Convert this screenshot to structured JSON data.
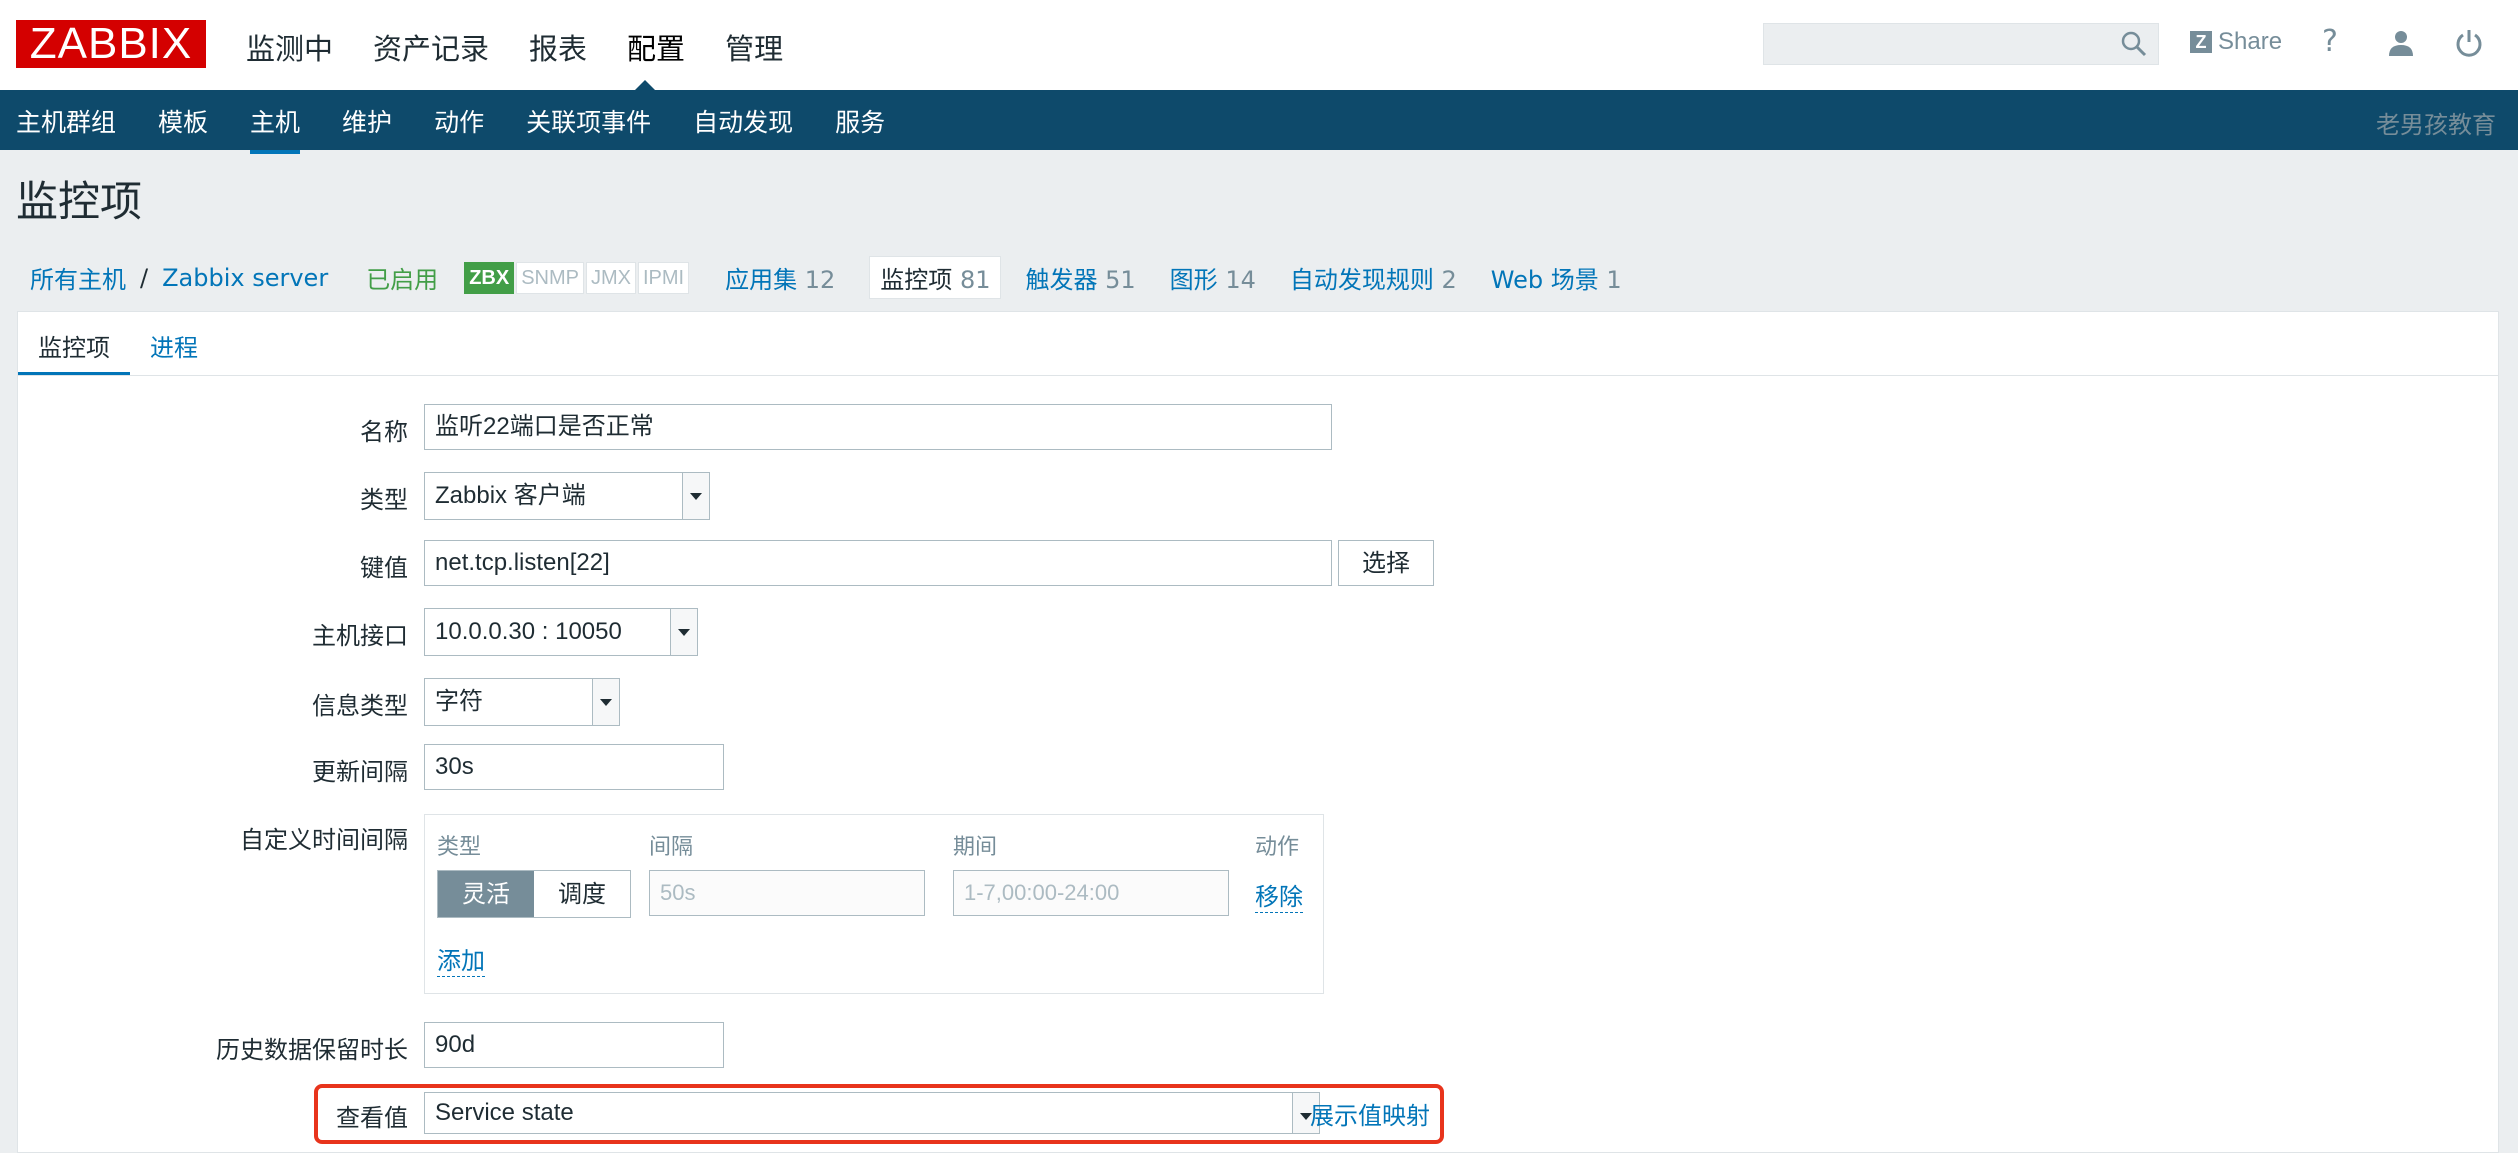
{
  "header": {
    "logo": "ZABBIX",
    "top_menu": [
      "监测中",
      "资产记录",
      "报表",
      "配置",
      "管理"
    ],
    "active_top": "配置",
    "search_placeholder": "",
    "share_label": "Share",
    "help_label": "?"
  },
  "subnav": {
    "items": [
      "主机群组",
      "模板",
      "主机",
      "维护",
      "动作",
      "关联项事件",
      "自动发现",
      "服务"
    ],
    "active": "主机",
    "brand": "老男孩教育"
  },
  "page_title": "监控项",
  "breadcrumb": {
    "all_hosts": "所有主机",
    "separator": "/",
    "host": "Zabbix server",
    "status": "已启用",
    "availability": [
      "ZBX",
      "SNMP",
      "JMX",
      "IPMI"
    ],
    "tabs": [
      {
        "label": "应用集",
        "count": "12"
      },
      {
        "label": "监控项",
        "count": "81"
      },
      {
        "label": "触发器",
        "count": "51"
      },
      {
        "label": "图形",
        "count": "14"
      },
      {
        "label": "自动发现规则",
        "count": "2"
      },
      {
        "label": "Web 场景",
        "count": "1"
      }
    ]
  },
  "form_tabs": [
    "监控项",
    "进程"
  ],
  "form": {
    "name_label": "名称",
    "name_value": "监听22端口是否正常",
    "type_label": "类型",
    "type_value": "Zabbix 客户端",
    "key_label": "键值",
    "key_value": "net.tcp.listen[22]",
    "key_select_button": "选择",
    "interface_label": "主机接口",
    "interface_value": "10.0.0.30 : 10050",
    "info_type_label": "信息类型",
    "info_type_value": "字符",
    "interval_label": "更新间隔",
    "interval_value": "30s",
    "custom_label": "自定义时间间隔",
    "custom": {
      "col_type": "类型",
      "col_interval": "间隔",
      "col_period": "期间",
      "col_action": "动作",
      "seg_flexible": "灵活",
      "seg_scheduling": "调度",
      "interval_placeholder": "50s",
      "period_placeholder": "1-7,00:00-24:00",
      "remove": "移除",
      "add": "添加"
    },
    "history_label": "历史数据保留时长",
    "history_value": "90d",
    "valuemap_label": "查看值",
    "valuemap_value": "Service state",
    "valuemap_link": "展示值映射"
  },
  "colors": {
    "nav_bg": "#0e4a6b",
    "logo_red": "#d40000",
    "link": "#0275b8",
    "enabled_green": "#429e47",
    "highlight": "#e8341c"
  }
}
